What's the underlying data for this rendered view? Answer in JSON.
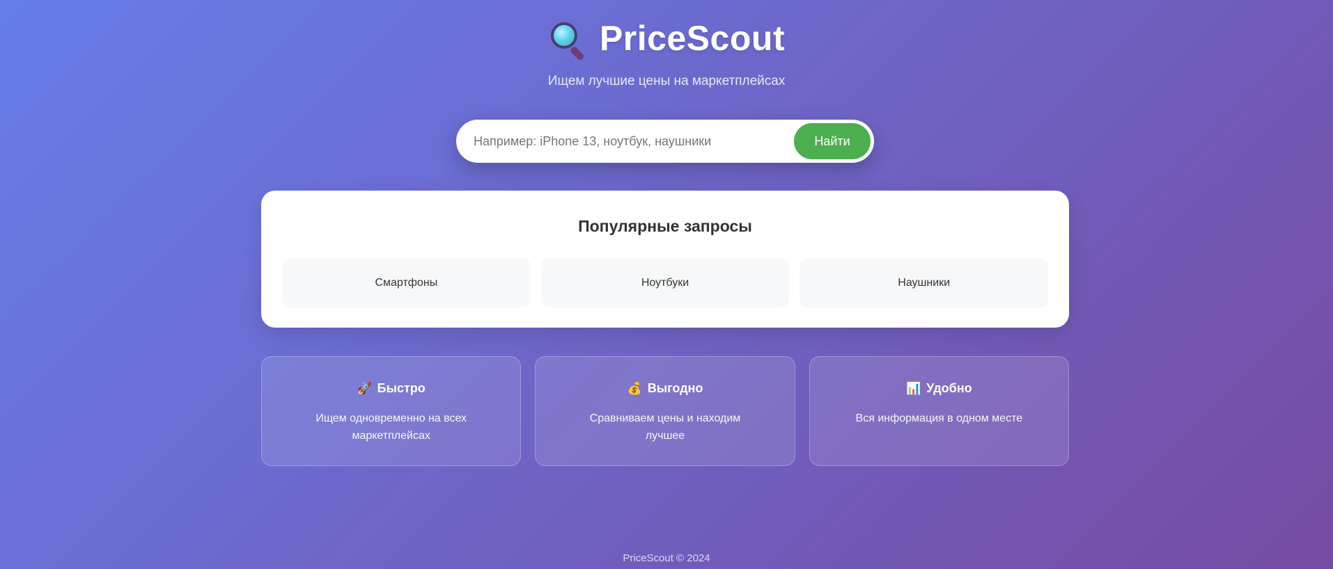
{
  "app": {
    "title": "PriceScout",
    "subtitle": "Ищем лучшие цены на маркетплейсах",
    "logo_icon": "magnifying-glass"
  },
  "search": {
    "placeholder": "Например: iPhone 13, ноутбук, наушники",
    "value": "",
    "button_label": "Найти",
    "button_color": "#4caf50"
  },
  "popular": {
    "heading": "Популярные запросы",
    "items": [
      {
        "label": "Смартфоны"
      },
      {
        "label": "Ноутбуки"
      },
      {
        "label": "Наушники"
      }
    ]
  },
  "features": [
    {
      "icon": "rocket",
      "glyph": "🚀",
      "title": "Быстро",
      "text": "Ищем одновременно на всех маркетплейсах"
    },
    {
      "icon": "money-bag",
      "glyph": "💰",
      "title": "Выгодно",
      "text": "Сравниваем цены и находим лучшее"
    },
    {
      "icon": "bar-chart",
      "glyph": "📊",
      "title": "Удобно",
      "text": "Вся информация в одном месте"
    }
  ],
  "footer": {
    "text": "PriceScout © 2024"
  },
  "colors": {
    "gradient_start": "#667eea",
    "gradient_end": "#764ba2"
  }
}
